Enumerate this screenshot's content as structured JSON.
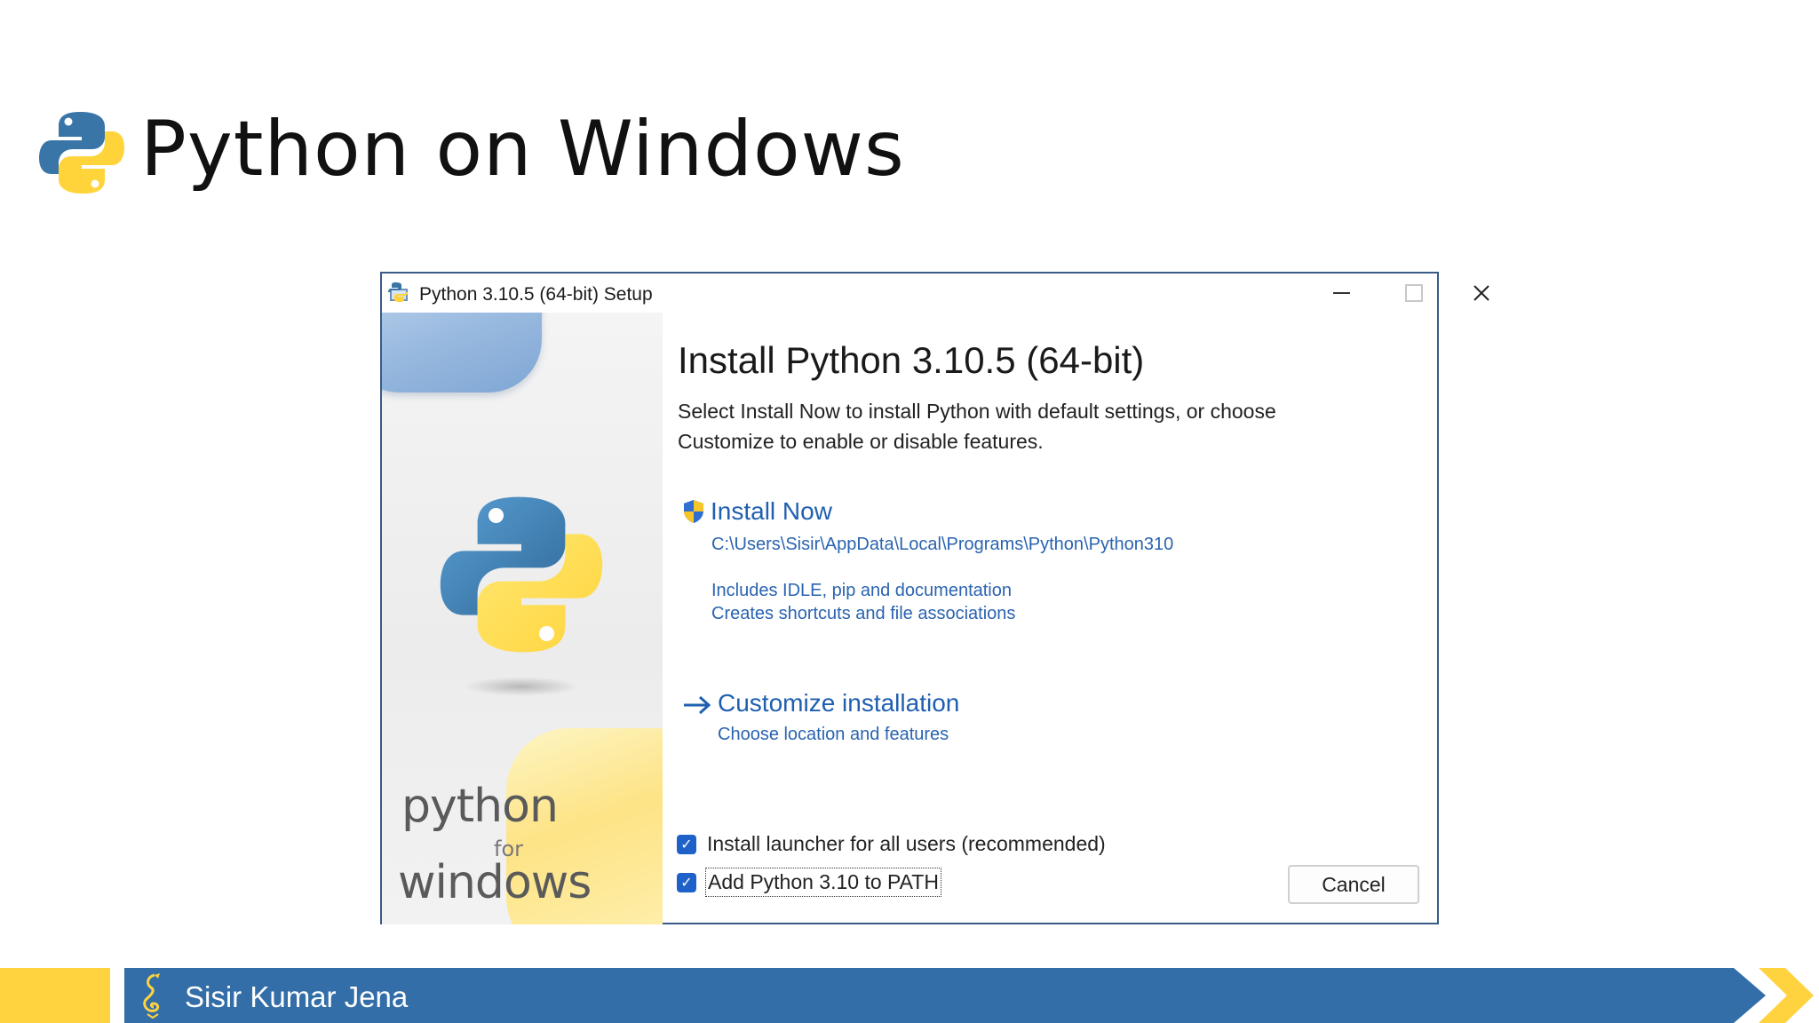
{
  "slide": {
    "title": "Python on Windows",
    "footer_name": "Sisir Kumar Jena"
  },
  "window": {
    "title": "Python 3.10.5 (64-bit) Setup",
    "heading": "Install Python 3.10.5 (64-bit)",
    "description": "Select Install Now to install Python with default settings, or choose Customize to enable or disable features.",
    "banner": {
      "python": "python",
      "for": "for",
      "windows": "windows"
    },
    "install_now": {
      "title": "Install Now",
      "path": "C:\\Users\\Sisir\\AppData\\Local\\Programs\\Python\\Python310",
      "detail_1": "Includes IDLE, pip and documentation",
      "detail_2": "Creates shortcuts and file associations"
    },
    "customize": {
      "title": "Customize installation",
      "detail": "Choose location and features"
    },
    "checkboxes": [
      {
        "label": "Install launcher for all users (recommended)",
        "checked": true
      },
      {
        "label": "Add Python 3.10 to PATH",
        "checked": true
      }
    ],
    "cancel_label": "Cancel"
  },
  "colors": {
    "link_blue": "#1f5fb0",
    "footer_blue": "#336ea8",
    "footer_yellow": "#ffd23f",
    "python_blue": "#3a75a8",
    "python_yellow": "#ffd43b"
  },
  "icons": [
    "python-logo-icon",
    "installer-app-icon",
    "shield-icon",
    "arrow-right-icon",
    "close-icon",
    "minimize-icon",
    "maximize-icon",
    "dragon-icon",
    "chevron-icon"
  ]
}
